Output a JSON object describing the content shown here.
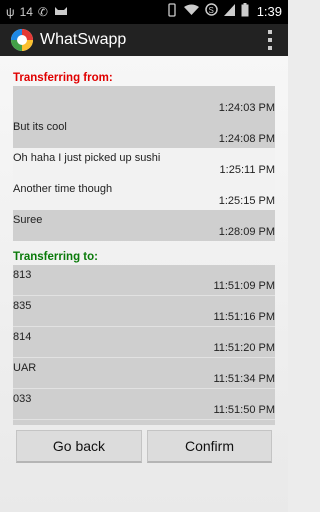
{
  "status_bar": {
    "left_icons": [
      "usb-icon",
      "notification-14-icon",
      "whatsapp-icon",
      "cat-icon"
    ],
    "badge_text": "14",
    "time": "1:39"
  },
  "action_bar": {
    "title": "WhatSwapp",
    "menu_icon": "overflow-menu-icon"
  },
  "from_section": {
    "title": "Transferring from:",
    "title_color": "#e00000",
    "items": [
      {
        "text": "",
        "time": "1:24:03 PM"
      },
      {
        "text": "But its cool",
        "time": "1:24:08 PM"
      },
      {
        "text": "Oh haha I just picked up sushi",
        "time": "1:25:11 PM"
      },
      {
        "text": "Another time though",
        "time": "1:25:15 PM"
      },
      {
        "text": "Suree",
        "time": "1:28:09 PM"
      }
    ]
  },
  "to_section": {
    "title": "Transferring to:",
    "title_color": "#0a7a0a",
    "items": [
      {
        "text": "813",
        "time": "11:51:09 PM"
      },
      {
        "text": "835",
        "time": "11:51:16 PM"
      },
      {
        "text": "814",
        "time": "11:51:20 PM"
      },
      {
        "text": "UAR",
        "time": "11:51:34 PM"
      },
      {
        "text": "033",
        "time": "11:51:50 PM"
      }
    ]
  },
  "buttons": {
    "back_label": "Go back",
    "confirm_label": "Confirm"
  }
}
